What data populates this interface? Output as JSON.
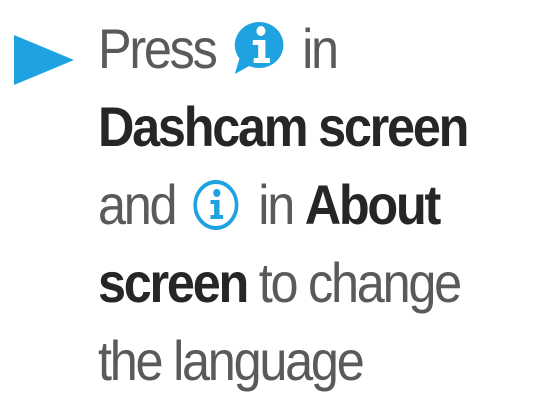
{
  "instruction": {
    "bullet_icon": "right-triangle-arrow-icon",
    "press_text": "Press",
    "first_icon": "info-speech-bubble-icon",
    "in_text_1": "in",
    "dashcam_screen_text": "Dashcam screen",
    "and_text": "and",
    "second_icon": "info-circle-outline-icon",
    "in_text_2": "in",
    "about_text": "About",
    "screen_text": "screen",
    "to_change_text": "to change",
    "the_language_text": "the language"
  },
  "colors": {
    "accent_blue": "#1ea3e0",
    "text_gray": "#5a5a5a",
    "text_bold": "#262626"
  }
}
